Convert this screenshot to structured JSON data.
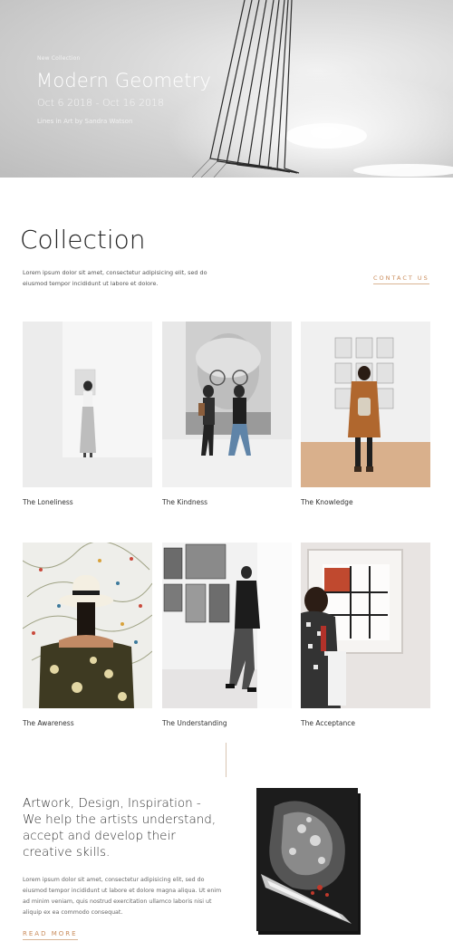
{
  "hero": {
    "kicker": "New Collection",
    "title": "Modern Geometry",
    "dates": "Oct 6 2018 - Oct 16 2018",
    "byline": "Lines in Art by Sandra Watson"
  },
  "collection": {
    "title": "Collection",
    "description": "Lorem ipsum dolor sit amet, consectetur adipisicing elit, sed do eiusmod tempor incididunt ut labore et dolore.",
    "contact_label": "CONTACT US",
    "items": [
      {
        "caption": "The Loneliness"
      },
      {
        "caption": "The Kindness"
      },
      {
        "caption": "The Knowledge"
      },
      {
        "caption": "The Awareness"
      },
      {
        "caption": "The Understanding"
      },
      {
        "caption": "The Acceptance"
      }
    ]
  },
  "about": {
    "heading": "Artwork, Design, Inspiration - We help the artists understand, accept and develop their creative skills.",
    "body": "Lorem ipsum dolor sit amet, consectetur adipisicing elit, sed do eiusmod tempor incididunt ut labore et dolore magna aliqua. Ut enim ad minim veniam, quis nostrud exercitation ullamco laboris nisi ut aliquip ex ea commodo consequat.",
    "read_more_label": "READ MORE"
  },
  "colors": {
    "accent": "#c98b5a",
    "text": "#333333",
    "background": "#ffffff"
  }
}
